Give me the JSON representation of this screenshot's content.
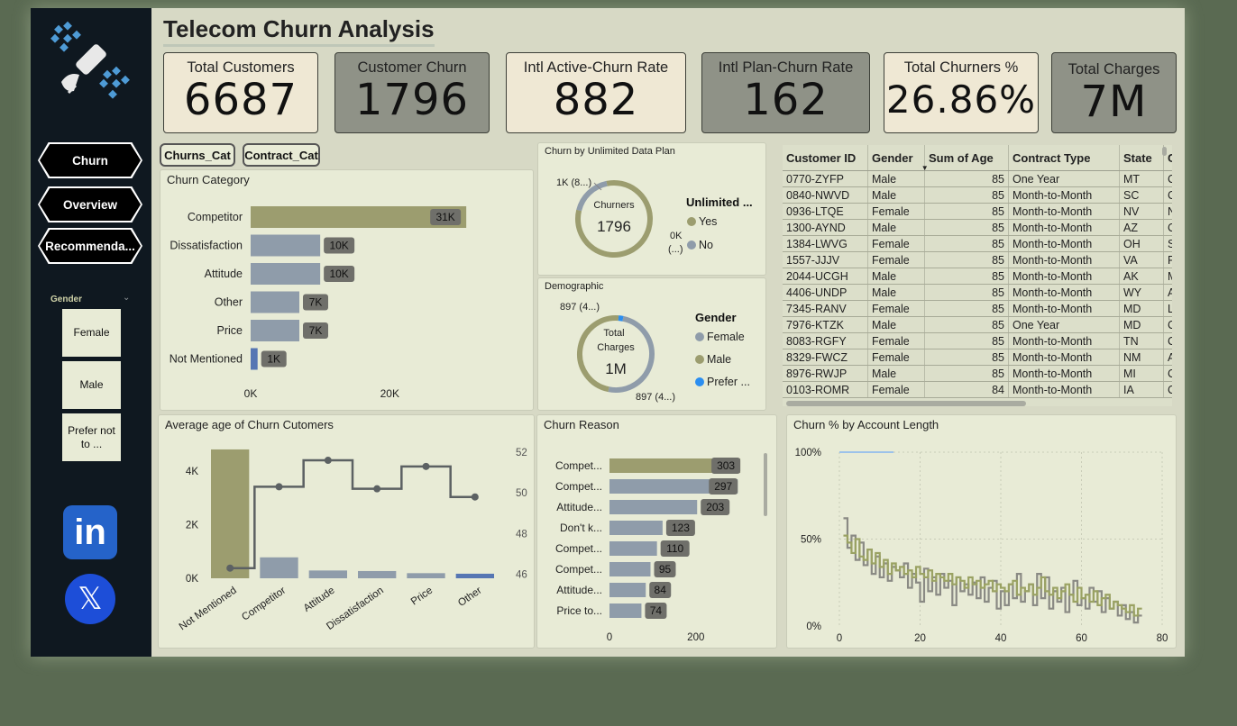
{
  "title": "Telecom Churn Analysis",
  "nav": [
    {
      "label": "Churn"
    },
    {
      "label": "Overview"
    },
    {
      "label": "Recommenda..."
    }
  ],
  "slicer": {
    "title": "Gender",
    "options": [
      "Female",
      "Male",
      "Prefer not to ..."
    ]
  },
  "kpis": [
    {
      "label": "Total Customers",
      "value": "6687"
    },
    {
      "label": "Customer Churn",
      "value": "1796"
    },
    {
      "label": "Intl Active-Churn Rate",
      "value": "882"
    },
    {
      "label": "Intl Plan-Churn Rate",
      "value": "162"
    },
    {
      "label": "Total Churners %",
      "value": "26.86%"
    },
    {
      "label": "Total Charges",
      "value": "7M"
    }
  ],
  "tabs": [
    "Churns_Cat",
    "Contract_Cat"
  ],
  "churn_category": {
    "title": "Churn Category",
    "categories": [
      "Competitor",
      "Dissatisfaction",
      "Attitude",
      "Other",
      "Price",
      "Not Mentioned"
    ],
    "values": [
      31000,
      10000,
      10000,
      7000,
      7000,
      1000
    ],
    "labels": [
      "31K",
      "10K",
      "10K",
      "7K",
      "7K",
      "1K"
    ],
    "xticks": [
      "0K",
      "20K"
    ],
    "xmax": 35000,
    "colors": [
      "#9c9d6f",
      "#8f9caa",
      "#8f9caa",
      "#8f9caa",
      "#8f9caa",
      "#5676b3"
    ]
  },
  "unlimited": {
    "title": "Churn by Unlimited Data Plan",
    "center_label": "Churners",
    "center_value": "1796",
    "label_top": "1K (8...)",
    "label_right_1": "0K",
    "label_right_2": "(...)",
    "legend_title": "Unlimited ...",
    "legend": [
      {
        "name": "Yes",
        "color": "#9c9d6f"
      },
      {
        "name": "No",
        "color": "#8f9caa"
      }
    ],
    "shares": [
      0.82,
      0.18
    ]
  },
  "demographic": {
    "title": "Demographic",
    "center_label_1": "Total",
    "center_label_2": "Charges",
    "center_value": "1M",
    "label_top": "897 (4...)",
    "label_bottom": "897 (4...)",
    "legend_title": "Gender",
    "legend": [
      {
        "name": "Female",
        "color": "#8f9caa"
      },
      {
        "name": "Male",
        "color": "#9c9d6f"
      },
      {
        "name": "Prefer ...",
        "color": "#2b8ef0"
      }
    ],
    "shares": [
      0.5,
      0.48,
      0.02
    ]
  },
  "customers_table": {
    "columns": [
      "Customer ID",
      "Gender",
      "Sum of Age",
      "Contract Type",
      "State",
      "Chur"
    ],
    "rows": [
      [
        "0770-ZYFP",
        "Male",
        "85",
        "One Year",
        "MT",
        "Com"
      ],
      [
        "0840-NWVD",
        "Male",
        "85",
        "Month-to-Month",
        "SC",
        "Com"
      ],
      [
        "0936-LTQE",
        "Female",
        "85",
        "Month-to-Month",
        "NV",
        "Netw"
      ],
      [
        "1300-AYND",
        "Male",
        "85",
        "Month-to-Month",
        "AZ",
        "Com"
      ],
      [
        "1384-LWVG",
        "Female",
        "85",
        "Month-to-Month",
        "OH",
        "Servi"
      ],
      [
        "1557-JJJV",
        "Female",
        "85",
        "Month-to-Month",
        "VA",
        "Prod"
      ],
      [
        "2044-UCGH",
        "Male",
        "85",
        "Month-to-Month",
        "AK",
        "Mov"
      ],
      [
        "4406-UNDP",
        "Male",
        "85",
        "Month-to-Month",
        "WY",
        "Attitu"
      ],
      [
        "7345-RANV",
        "Female",
        "85",
        "Month-to-Month",
        "MD",
        "Long"
      ],
      [
        "7976-KTZK",
        "Male",
        "85",
        "One Year",
        "MD",
        "Com"
      ],
      [
        "8083-RGFY",
        "Female",
        "85",
        "Month-to-Month",
        "TN",
        "Com"
      ],
      [
        "8329-FWCZ",
        "Female",
        "85",
        "Month-to-Month",
        "NM",
        "Attitu"
      ],
      [
        "8976-RWJP",
        "Male",
        "85",
        "Month-to-Month",
        "MI",
        "Com"
      ],
      [
        "0103-ROMR",
        "Female",
        "84",
        "Month-to-Month",
        "IA",
        "Com"
      ]
    ]
  },
  "chart_data": [
    {
      "type": "bar",
      "title": "Average age of Churn Cutomers",
      "categories": [
        "Not Mentioned",
        "Competitor",
        "Attitude",
        "Dissatisfaction",
        "Price",
        "Other"
      ],
      "series": [
        {
          "values": [
            4800,
            780,
            290,
            270,
            190,
            170
          ],
          "axis": "left"
        },
        {
          "type": "line",
          "values": [
            46.3,
            50.3,
            51.6,
            50.2,
            51.3,
            49.8
          ],
          "axis": "right"
        }
      ],
      "yticks_left": [
        "4K",
        "2K",
        "0K"
      ],
      "yticks_right": [
        "52",
        "50",
        "48",
        "46"
      ],
      "ylim_left": [
        0,
        5000
      ],
      "ylim_right": [
        45.8,
        52.4
      ]
    },
    {
      "type": "bar",
      "title": "Churn Reason",
      "categories": [
        "Compet...",
        "Compet...",
        "Attitude...",
        "Don't k...",
        "Compet...",
        "Compet...",
        "Attitude...",
        "Price to..."
      ],
      "values": [
        303,
        297,
        203,
        123,
        110,
        95,
        84,
        74
      ],
      "xticks": [
        "0",
        "200"
      ],
      "xlim": [
        0,
        400
      ]
    },
    {
      "type": "line",
      "title": "Churn % by Account Length",
      "yticks": [
        "100%",
        "50%",
        "0%"
      ],
      "xticks": [
        "0",
        "20",
        "40",
        "60",
        "80"
      ],
      "xlim": [
        0,
        80
      ],
      "ylim": [
        0,
        100
      ],
      "series": [
        {
          "color": "#8a8a84",
          "values": [
            62,
            45,
            52,
            38,
            48,
            35,
            44,
            30,
            40,
            28,
            36,
            26,
            34,
            32,
            28,
            36,
            22,
            30,
            25,
            14,
            33,
            20,
            28,
            18,
            30,
            22,
            26,
            12,
            28,
            20,
            24,
            18,
            25,
            16,
            28,
            14,
            22,
            26,
            10,
            20,
            12,
            24,
            16,
            30,
            14,
            20,
            24,
            12,
            30,
            16,
            28,
            10,
            20,
            14,
            22,
            8,
            18,
            26,
            12,
            16,
            10,
            22,
            14,
            20,
            8,
            16,
            10,
            14,
            6,
            12,
            4,
            8,
            2,
            6
          ]
        },
        {
          "color": "#9aa263",
          "values": [
            52,
            48,
            42,
            50,
            40,
            38,
            44,
            36,
            42,
            34,
            38,
            30,
            36,
            32,
            34,
            30,
            32,
            28,
            34,
            30,
            28,
            32,
            26,
            30,
            28,
            26,
            30,
            24,
            28,
            26,
            22,
            28,
            24,
            26,
            22,
            24,
            26,
            20,
            24,
            22,
            20,
            24,
            26,
            18,
            22,
            20,
            24,
            18,
            22,
            28,
            20,
            18,
            22,
            16,
            20,
            24,
            18,
            14,
            22,
            16,
            18,
            14,
            20,
            12,
            16,
            18,
            10,
            14,
            12,
            10,
            8,
            12,
            6,
            10
          ]
        }
      ]
    }
  ]
}
